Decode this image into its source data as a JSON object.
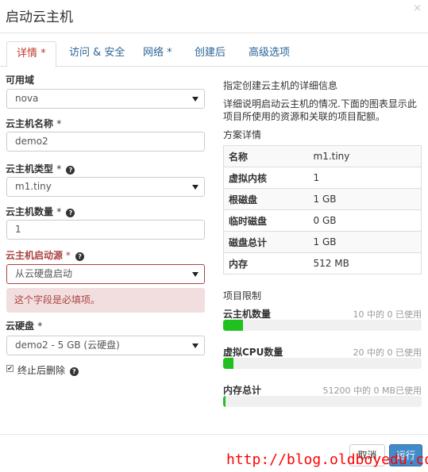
{
  "modal": {
    "title": "启动云主机",
    "close_glyph": "×"
  },
  "tabs": [
    {
      "label": "详情 *"
    },
    {
      "label": "访问 & 安全"
    },
    {
      "label": "网络 *"
    },
    {
      "label": "创建后"
    },
    {
      "label": "高级选项"
    }
  ],
  "form": {
    "zone": {
      "label": "可用域",
      "value": "nova"
    },
    "name": {
      "label": "云主机名称",
      "required": "*",
      "value": "demo2"
    },
    "flavor": {
      "label": "云主机类型",
      "required": "*",
      "value": "m1.tiny"
    },
    "count": {
      "label": "云主机数量",
      "required": "*",
      "value": "1"
    },
    "boot_source": {
      "label": "云主机启动源",
      "required": " *",
      "value": "从云硬盘启动",
      "error": "这个字段是必填项。"
    },
    "volume": {
      "label": "云硬盘",
      "required": "*",
      "value": "demo2 - 5 GB (云硬盘)"
    },
    "delete_on_terminate": {
      "label": "终止后删除",
      "checked": true,
      "check_glyph": "✔"
    },
    "help_glyph": "?"
  },
  "side": {
    "heading": "指定创建云主机的详细信息",
    "description": "详细说明启动云主机的情况.下面的图表显示此项目所使用的资源和关联的项目配额。",
    "flavor_heading": "方案详情",
    "flavor_rows": [
      {
        "key": "名称",
        "value": "m1.tiny"
      },
      {
        "key": "虚拟内核",
        "value": "1"
      },
      {
        "key": "根磁盘",
        "value": "1 GB"
      },
      {
        "key": "临时磁盘",
        "value": "0 GB"
      },
      {
        "key": "磁盘总计",
        "value": "1 GB"
      },
      {
        "key": "内存",
        "value": "512 MB"
      }
    ],
    "limits_heading": "项目限制",
    "quotas": [
      {
        "label": "云主机数量",
        "usage": "10 中的 0 已使用",
        "fill_fraction": 0.1
      },
      {
        "label": "虚拟CPU数量",
        "usage": "20 中的 0 已使用",
        "fill_fraction": 0.05
      },
      {
        "label": "内存总计",
        "usage": "51200 中的 0 MB已使用",
        "fill_fraction": 0.01
      }
    ]
  },
  "footer": {
    "cancel_label": "取消",
    "run_label": "运行"
  },
  "watermark": "http://blog.oldboyedu.com",
  "colors": {
    "accent": "#428bca",
    "error": "#a94442",
    "quota_fill": "#20c020"
  }
}
